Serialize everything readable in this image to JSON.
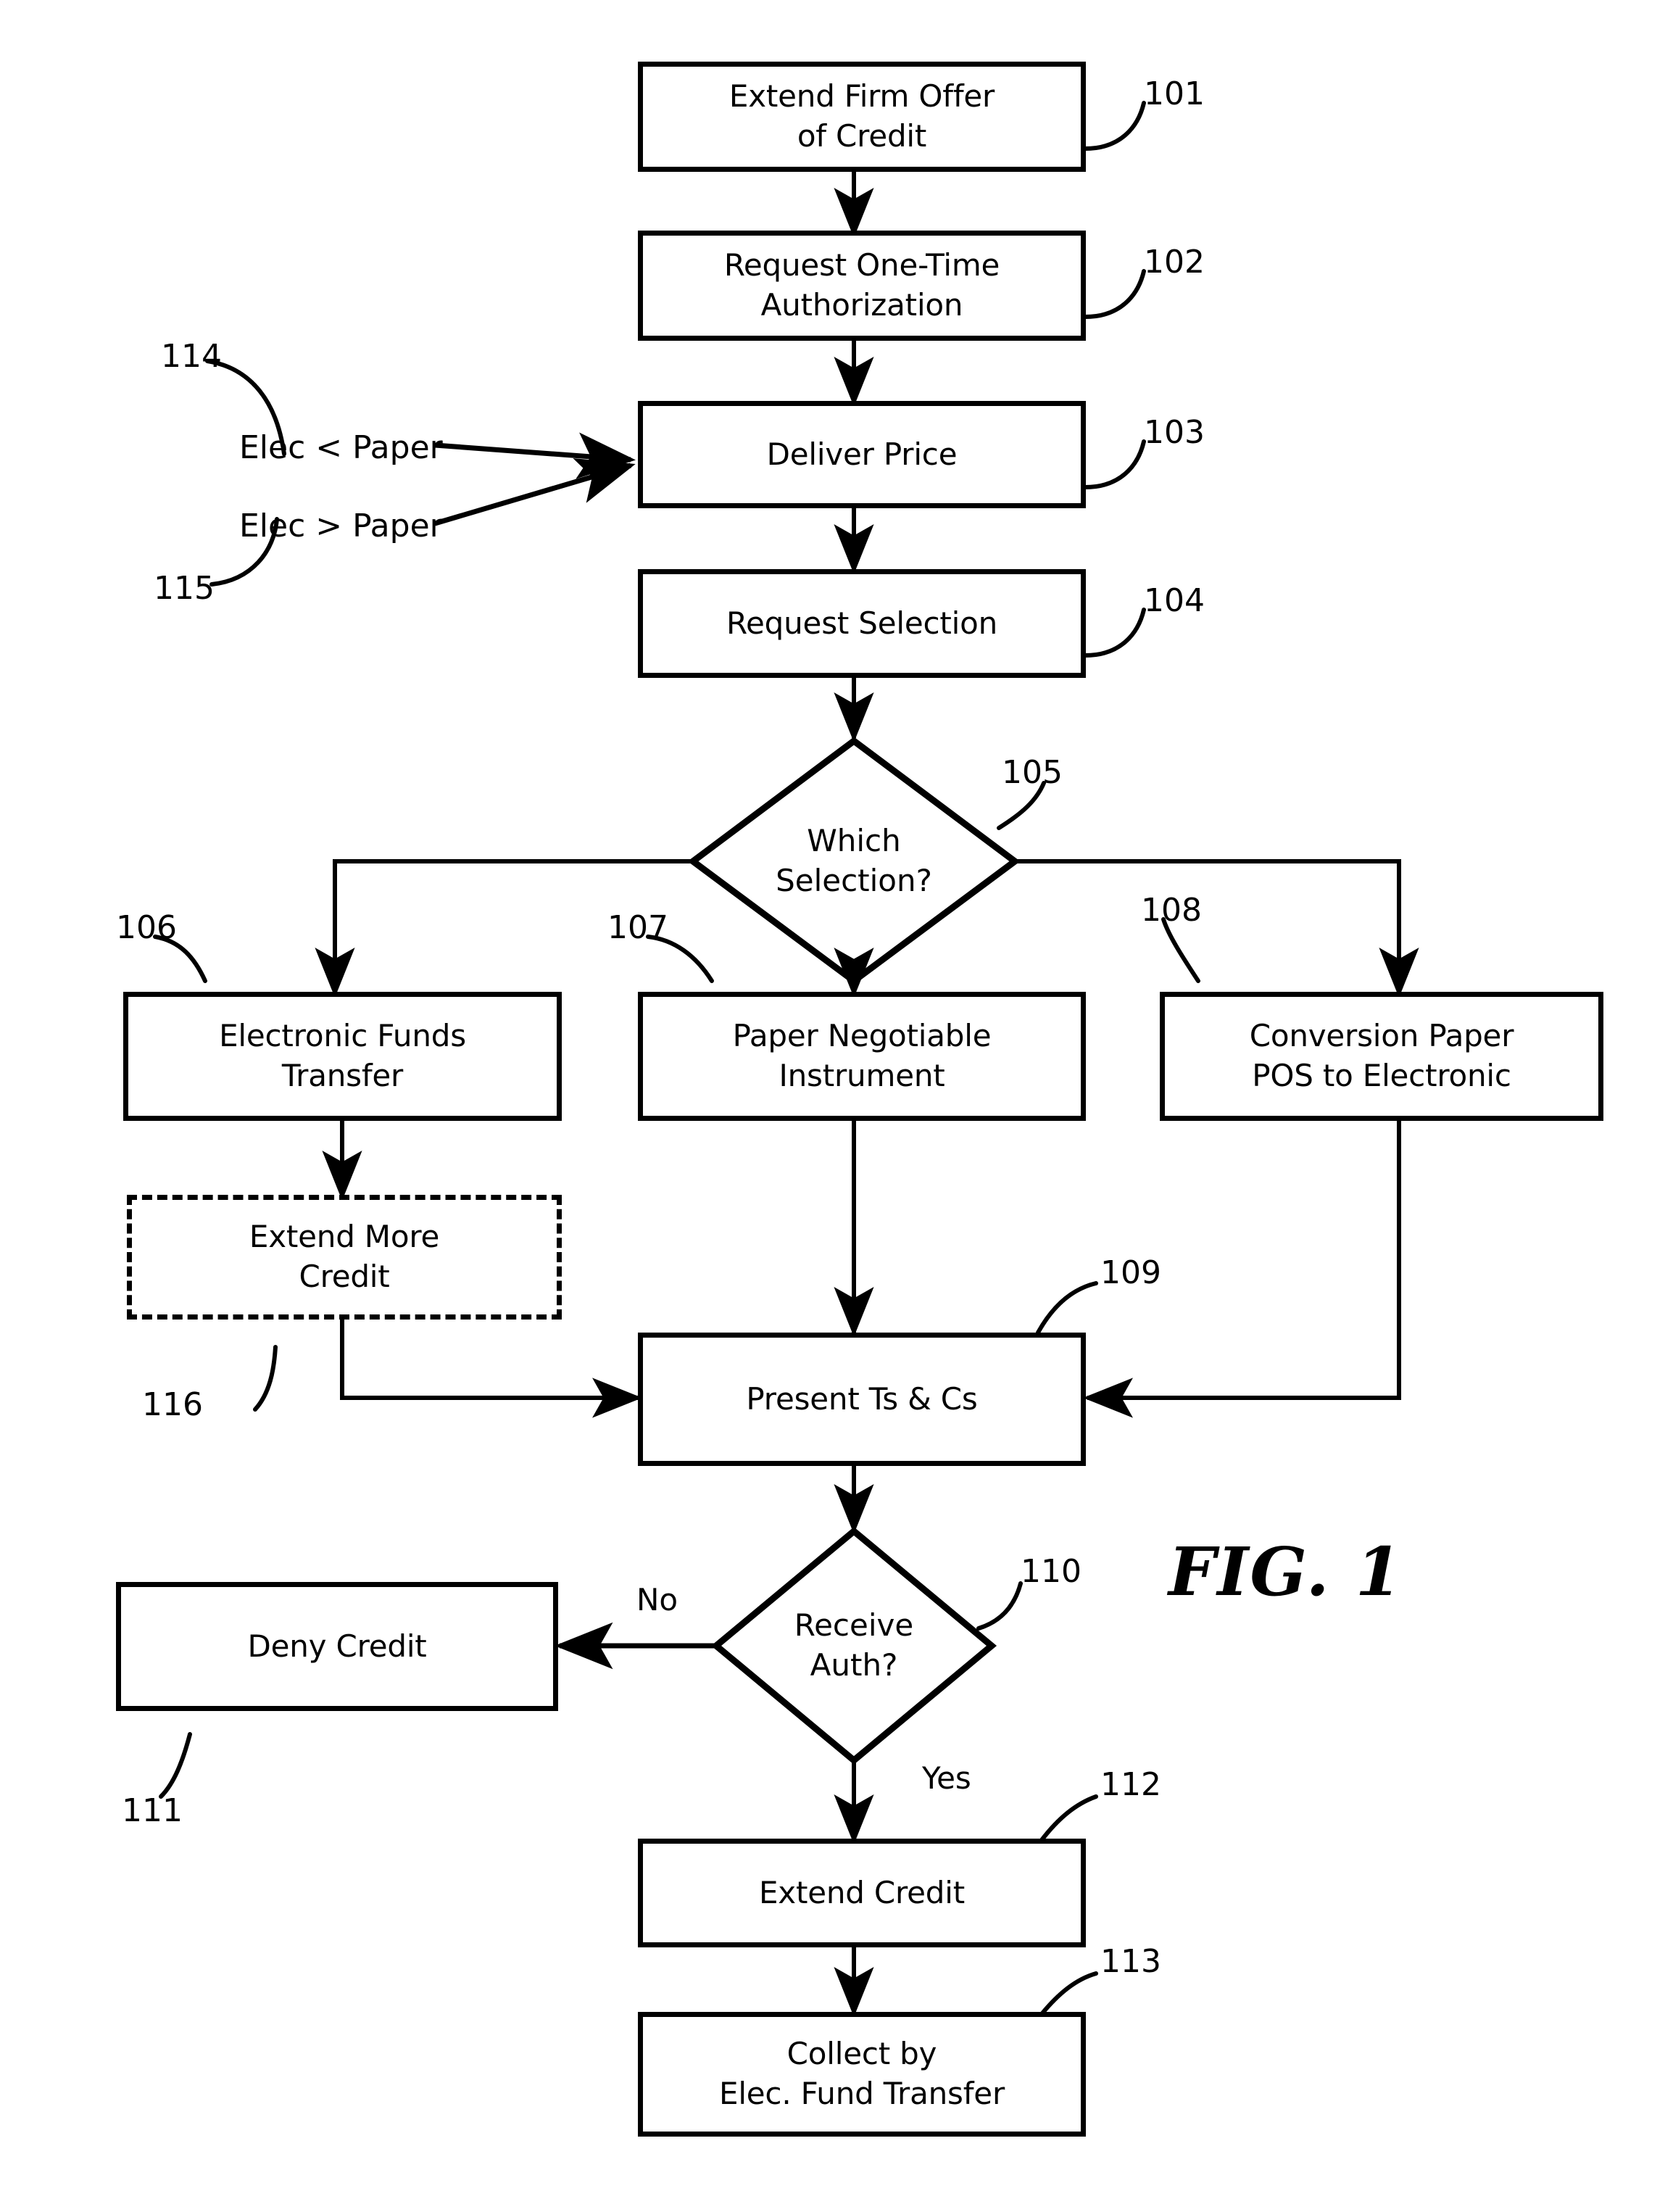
{
  "figure": {
    "caption": "FIG. 1",
    "type": "flowchart"
  },
  "nodes": [
    {
      "id": "101",
      "ref": "101",
      "label": "Extend Firm Offer\nof Credit",
      "shape": "process"
    },
    {
      "id": "102",
      "ref": "102",
      "label": "Request One-Time\nAuthorization",
      "shape": "process"
    },
    {
      "id": "103",
      "ref": "103",
      "label": "Deliver Price",
      "shape": "process"
    },
    {
      "id": "104",
      "ref": "104",
      "label": "Request Selection",
      "shape": "process"
    },
    {
      "id": "105",
      "ref": "105",
      "label": "Which\nSelection?",
      "shape": "decision"
    },
    {
      "id": "106",
      "ref": "106",
      "label": "Electronic Funds\nTransfer",
      "shape": "process"
    },
    {
      "id": "107",
      "ref": "107",
      "label": "Paper Negotiable\nInstrument",
      "shape": "process"
    },
    {
      "id": "108",
      "ref": "108",
      "label": "Conversion Paper\nPOS to Electronic",
      "shape": "process"
    },
    {
      "id": "109",
      "ref": "109",
      "label": "Present Ts & Cs",
      "shape": "process"
    },
    {
      "id": "110",
      "ref": "110",
      "label": "Receive\nAuth?",
      "shape": "decision"
    },
    {
      "id": "111",
      "ref": "111",
      "label": "Deny Credit",
      "shape": "process"
    },
    {
      "id": "112",
      "ref": "112",
      "label": "Extend Credit",
      "shape": "process"
    },
    {
      "id": "113",
      "ref": "113",
      "label": "Collect by\nElec. Fund Transfer",
      "shape": "process"
    },
    {
      "id": "116",
      "ref": "116",
      "label": "Extend More\nCredit",
      "shape": "process-optional-dashed"
    }
  ],
  "annotations": [
    {
      "id": "114",
      "ref": "114",
      "label": "Elec < Paper"
    },
    {
      "id": "115",
      "ref": "115",
      "label": "Elec > Paper"
    }
  ],
  "edge_labels": {
    "no": "No",
    "yes": "Yes"
  },
  "refs": {
    "r101": "101",
    "r102": "102",
    "r103": "103",
    "r104": "104",
    "r105": "105",
    "r106": "106",
    "r107": "107",
    "r108": "108",
    "r109": "109",
    "r110": "110",
    "r111": "111",
    "r112": "112",
    "r113": "113",
    "r114": "114",
    "r115": "115",
    "r116": "116"
  },
  "labels": {
    "n101": "Extend Firm Offer\nof Credit",
    "n102": "Request One-Time\nAuthorization",
    "n103": "Deliver Price",
    "n104": "Request Selection",
    "n105": "Which\nSelection?",
    "n106": "Electronic Funds\nTransfer",
    "n107": "Paper Negotiable\nInstrument",
    "n108": "Conversion Paper\nPOS to Electronic",
    "n109": "Present Ts & Cs",
    "n110": "Receive\nAuth?",
    "n111": "Deny Credit",
    "n112": "Extend Credit",
    "n113": "Collect by\nElec. Fund Transfer",
    "n116": "Extend More\nCredit",
    "a114": "Elec < Paper",
    "a115": "Elec > Paper",
    "no": "No",
    "yes": "Yes",
    "caption": "FIG. 1"
  },
  "colors": {
    "ink": "#000000",
    "paper": "#ffffff"
  }
}
